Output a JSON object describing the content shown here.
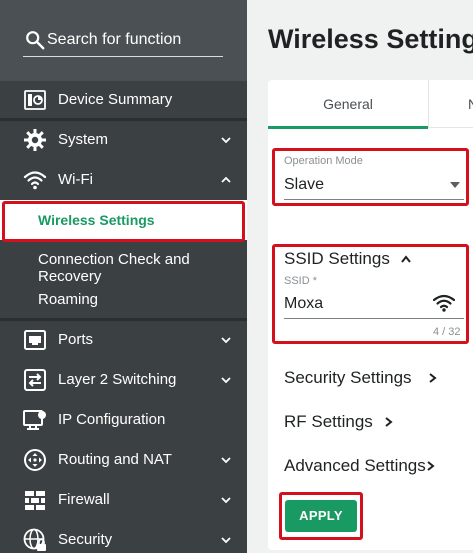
{
  "search": {
    "label": "Search for function"
  },
  "sidebar": {
    "items": [
      {
        "label": "Device Summary",
        "icon": "device-summary-icon"
      },
      {
        "label": "System",
        "icon": "gear-icon"
      },
      {
        "label": "Wi-Fi",
        "icon": "wifi-icon"
      },
      {
        "label": "Ports",
        "icon": "ethernet-port-icon"
      },
      {
        "label": "Layer 2 Switching",
        "icon": "switching-arrows-icon"
      },
      {
        "label": "IP Configuration",
        "icon": "ip-config-icon"
      },
      {
        "label": "Routing and NAT",
        "icon": "routing-icon"
      },
      {
        "label": "Firewall",
        "icon": "firewall-icon"
      },
      {
        "label": "Security",
        "icon": "security-globe-lock-icon"
      }
    ],
    "wifi_subitems": [
      {
        "label": "Wireless Settings"
      },
      {
        "label": "Connection Check and Recovery"
      },
      {
        "label": "Roaming"
      }
    ]
  },
  "main": {
    "title": "Wireless Settings",
    "tabs": [
      {
        "label": "General"
      },
      {
        "label": "N"
      }
    ],
    "operation_mode": {
      "label": "Operation Mode",
      "value": "Slave"
    },
    "ssid_settings": {
      "title": "SSID Settings",
      "ssid_label": "SSID *",
      "ssid_value": "Moxa",
      "counter": "4 / 32"
    },
    "sections": [
      {
        "title": "Security Settings"
      },
      {
        "title": "RF Settings"
      },
      {
        "title": "Advanced Settings"
      }
    ],
    "apply_label": "APPLY"
  },
  "colors": {
    "accent": "#1a9a63",
    "highlight": "#d4101d",
    "sidebar_bg": "#3b4042"
  }
}
